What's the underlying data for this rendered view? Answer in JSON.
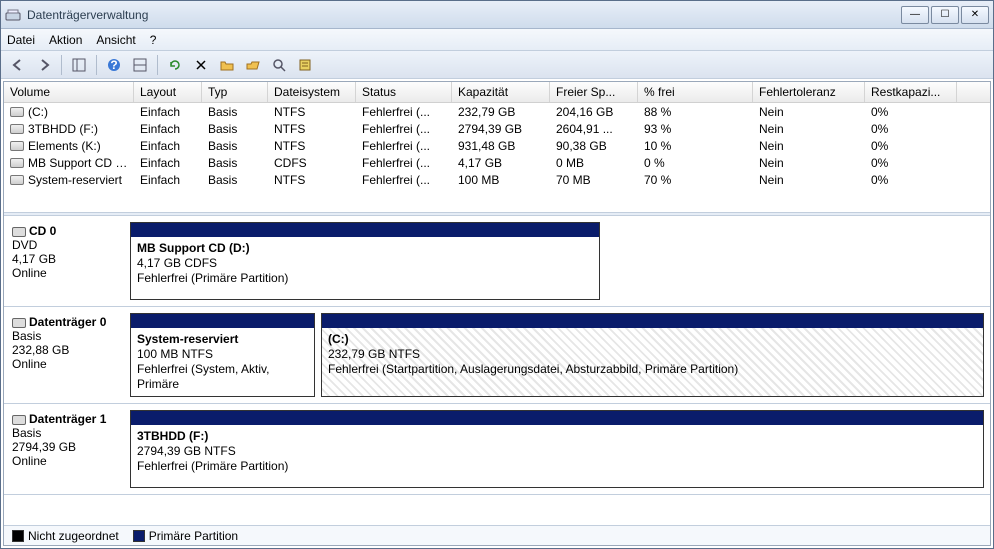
{
  "window": {
    "title": "Datenträgerverwaltung"
  },
  "menu": {
    "file": "Datei",
    "action": "Aktion",
    "view": "Ansicht",
    "help": "?"
  },
  "columns": [
    "Volume",
    "Layout",
    "Typ",
    "Dateisystem",
    "Status",
    "Kapazität",
    "Freier Sp...",
    "% frei",
    "Fehlertoleranz",
    "Restkapazi..."
  ],
  "volumes": [
    {
      "name": "(C:)",
      "layout": "Einfach",
      "type": "Basis",
      "fs": "NTFS",
      "status": "Fehlerfrei (...",
      "cap": "232,79 GB",
      "free": "204,16 GB",
      "pct": "88 %",
      "fault": "Nein",
      "rest": "0%"
    },
    {
      "name": "3TBHDD (F:)",
      "layout": "Einfach",
      "type": "Basis",
      "fs": "NTFS",
      "status": "Fehlerfrei (...",
      "cap": "2794,39 GB",
      "free": "2604,91 ...",
      "pct": "93 %",
      "fault": "Nein",
      "rest": "0%"
    },
    {
      "name": "Elements (K:)",
      "layout": "Einfach",
      "type": "Basis",
      "fs": "NTFS",
      "status": "Fehlerfrei (...",
      "cap": "931,48 GB",
      "free": "90,38 GB",
      "pct": "10 %",
      "fault": "Nein",
      "rest": "0%"
    },
    {
      "name": "MB Support CD (D:)",
      "layout": "Einfach",
      "type": "Basis",
      "fs": "CDFS",
      "status": "Fehlerfrei (...",
      "cap": "4,17 GB",
      "free": "0 MB",
      "pct": "0 %",
      "fault": "Nein",
      "rest": "0%"
    },
    {
      "name": "System-reserviert",
      "layout": "Einfach",
      "type": "Basis",
      "fs": "NTFS",
      "status": "Fehlerfrei (...",
      "cap": "100 MB",
      "free": "70 MB",
      "pct": "70 %",
      "fault": "Nein",
      "rest": "0%"
    }
  ],
  "disks": [
    {
      "title": "CD 0",
      "type": "DVD",
      "size": "4,17 GB",
      "status": "Online",
      "parts": [
        {
          "name": "MB Support CD  (D:)",
          "line2": "4,17 GB CDFS",
          "line3": "Fehlerfrei (Primäre Partition)",
          "flex": "0 0 470px",
          "hatched": false
        }
      ]
    },
    {
      "title": "Datenträger 0",
      "type": "Basis",
      "size": "232,88 GB",
      "status": "Online",
      "parts": [
        {
          "name": "System-reserviert",
          "line2": "100 MB NTFS",
          "line3": "Fehlerfrei (System, Aktiv, Primäre",
          "flex": "0 0 185px",
          "hatched": false
        },
        {
          "name": "(C:)",
          "line2": "232,79 GB NTFS",
          "line3": "Fehlerfrei (Startpartition, Auslagerungsdatei, Absturzabbild, Primäre Partition)",
          "flex": "1",
          "hatched": true
        }
      ]
    },
    {
      "title": "Datenträger 1",
      "type": "Basis",
      "size": "2794,39 GB",
      "status": "Online",
      "parts": [
        {
          "name": "3TBHDD  (F:)",
          "line2": "2794,39 GB NTFS",
          "line3": "Fehlerfrei (Primäre Partition)",
          "flex": "1",
          "hatched": false
        }
      ]
    }
  ],
  "legend": {
    "unalloc": "Nicht zugeordnet",
    "primary": "Primäre Partition"
  }
}
